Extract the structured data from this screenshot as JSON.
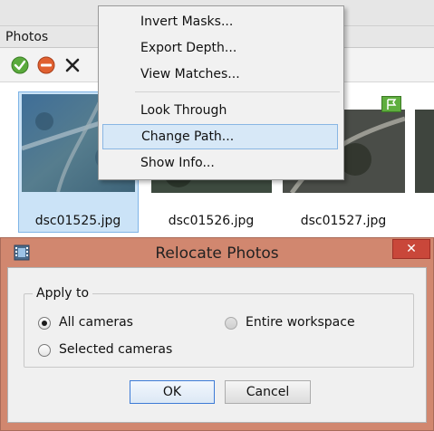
{
  "panel": {
    "title": "Photos",
    "toolbar": [
      {
        "name": "enable-camera-button",
        "icon": "check-icon",
        "color": "#5aaa3c"
      },
      {
        "name": "disable-camera-button",
        "icon": "no-entry-icon",
        "color": "#e06030"
      },
      {
        "name": "remove-button",
        "icon": "close-icon",
        "color": "#222222"
      }
    ],
    "thumbnails": [
      {
        "label": "dsc01525.jpg",
        "selected": true
      },
      {
        "label": "dsc01526.jpg",
        "selected": false
      },
      {
        "label": "dsc01527.jpg",
        "selected": false,
        "badge": "flag-icon"
      }
    ]
  },
  "context_menu": {
    "items": [
      {
        "label": "Invert Masks..."
      },
      {
        "label": "Export Depth..."
      },
      {
        "label": "View Matches..."
      },
      {
        "label": "Look Through"
      },
      {
        "label": "Change Path...",
        "highlighted": true
      },
      {
        "label": "Show Info..."
      }
    ]
  },
  "dialog": {
    "title": "Relocate Photos",
    "close_label": "✕",
    "group_label": "Apply to",
    "options": {
      "all_cameras": {
        "label": "All cameras",
        "checked": true
      },
      "entire_workspace": {
        "label": "Entire workspace",
        "checked": false,
        "enabled": false
      },
      "selected_cameras": {
        "label": "Selected cameras",
        "checked": false
      }
    },
    "ok_label": "OK",
    "cancel_label": "Cancel"
  }
}
